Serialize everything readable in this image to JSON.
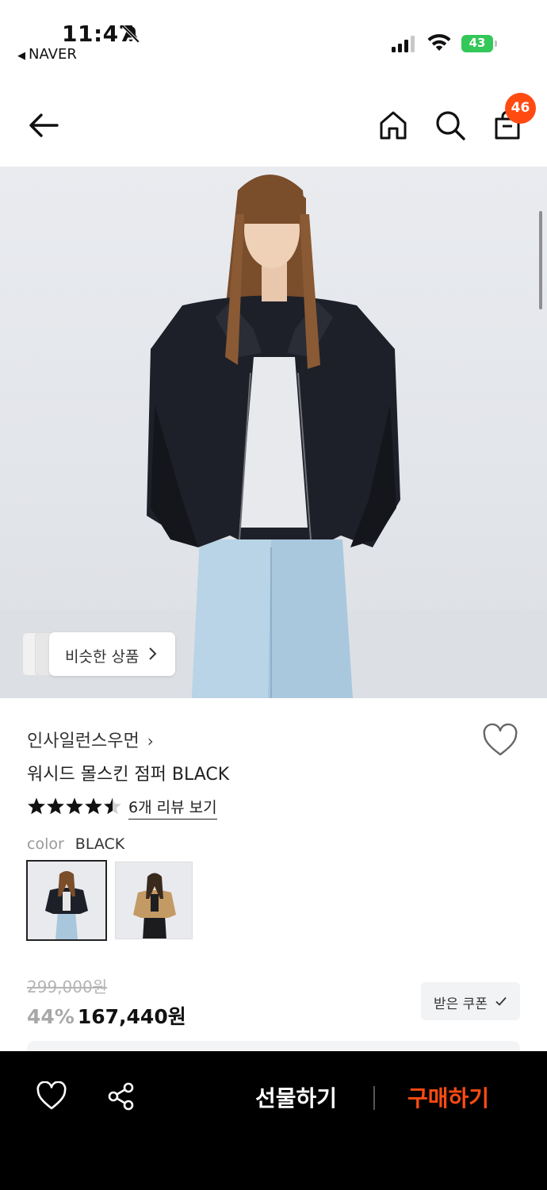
{
  "status_bar": {
    "time": "11:47",
    "back_app": "NAVER",
    "battery": "43"
  },
  "header": {
    "back_icon": "arrow-left-icon",
    "home_icon": "home-icon",
    "search_icon": "search-icon",
    "cart_icon": "shopping-bag-icon",
    "cart_count": "46",
    "badge_color": "#ff4b12"
  },
  "hero": {
    "similar_label": "비슷한 상품"
  },
  "product": {
    "brand": "인사일런스우먼",
    "title": "워시드 몰스킨 점퍼 BLACK",
    "rating": 4.5,
    "reviews_link": "6개 리뷰 보기",
    "color_key": "color",
    "color_value": "BLACK",
    "swatches": [
      "BLACK",
      "BEIGE"
    ],
    "original_price": "299,000원",
    "discount": "44%",
    "price": "167,440원",
    "coupon_label": "받은 쿠폰"
  },
  "bottom_bar": {
    "gift_label": "선물하기",
    "buy_label": "구매하기",
    "accent_color": "#ff4b12"
  }
}
